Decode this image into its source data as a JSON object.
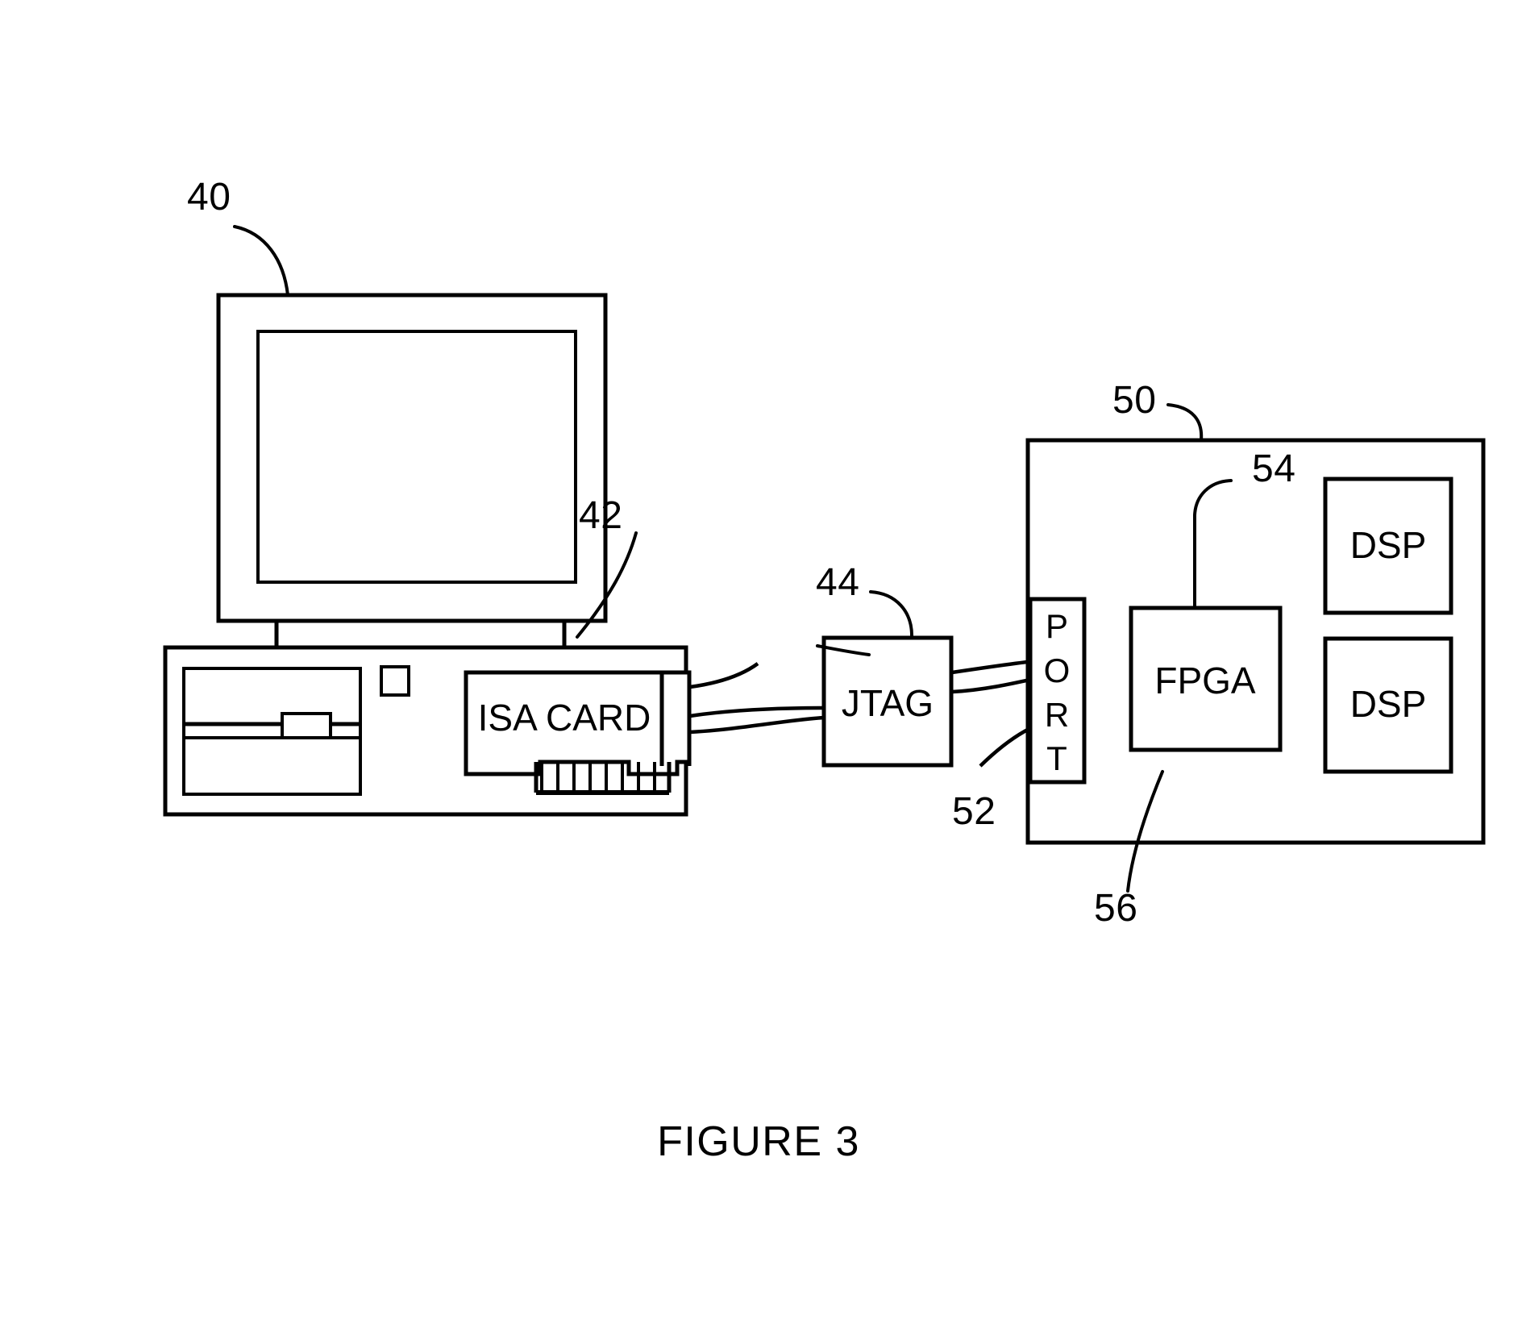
{
  "figure": {
    "caption": "FIGURE 3",
    "domain_note": "patent line drawing"
  },
  "colors": {
    "ink": "#000000",
    "paper": "#ffffff"
  },
  "reference_numerals": [
    {
      "id": "40",
      "text": "40",
      "points_to": "computer-monitor"
    },
    {
      "id": "42",
      "text": "42",
      "points_to": "isa-card-connector"
    },
    {
      "id": "44",
      "text": "44",
      "points_to": "jtag-box"
    },
    {
      "id": "50",
      "text": "50",
      "points_to": "target-board"
    },
    {
      "id": "52",
      "text": "52",
      "points_to": "port-block"
    },
    {
      "id": "54",
      "text": "54",
      "points_to": "fpga-block"
    },
    {
      "id": "56",
      "text": "56",
      "points_to": "dsp-block-lower"
    }
  ],
  "blocks": {
    "isa_card": {
      "label": "ISA CARD"
    },
    "jtag": {
      "label": "JTAG"
    },
    "port": {
      "label": "PORT",
      "letters": [
        "P",
        "O",
        "R",
        "T"
      ]
    },
    "fpga": {
      "label": "FPGA"
    },
    "dsp_upper": {
      "label": "DSP"
    },
    "dsp_lower": {
      "label": "DSP"
    }
  },
  "components": {
    "monitor": "computer-monitor",
    "tower": "computer-base-chassis",
    "floppy_slot": "floppy-drive-slot",
    "power_button": "power-button",
    "edge_connector": "card-edge-contacts",
    "cable_1": "isa-to-jtag-cable",
    "cable_2": "jtag-to-port-cable",
    "board": "target-board"
  }
}
